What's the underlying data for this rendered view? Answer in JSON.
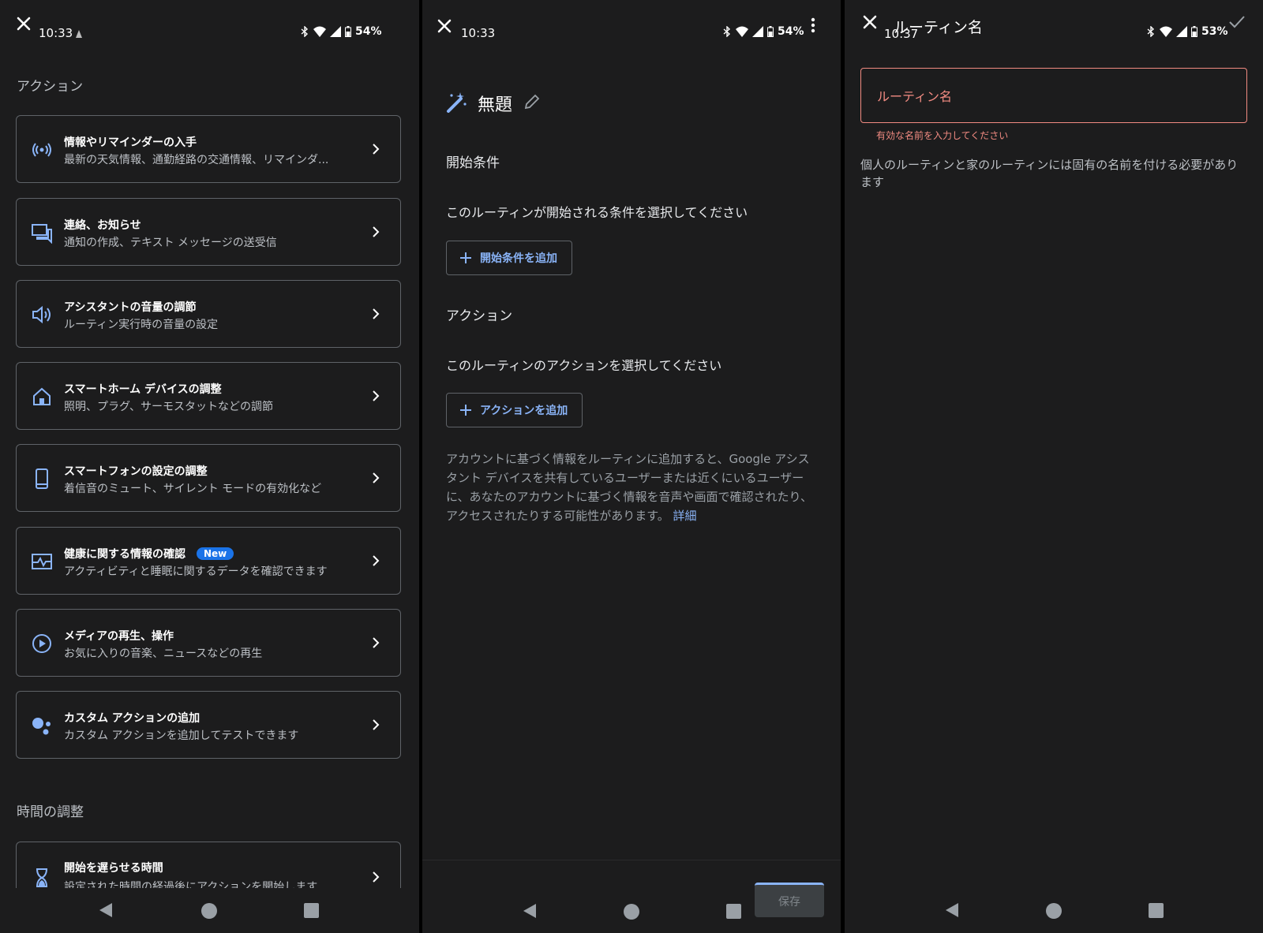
{
  "panel1": {
    "status": {
      "time": "10:33",
      "battery": "54%"
    },
    "section_actions": "アクション",
    "cards": [
      {
        "title": "情報やリマインダーの入手",
        "subtitle": "最新の天気情報、通勤経路の交通情報、リマインダ..."
      },
      {
        "title": "連絡、お知らせ",
        "subtitle": "通知の作成、テキスト メッセージの送受信"
      },
      {
        "title": "アシスタントの音量の調節",
        "subtitle": "ルーティン実行時の音量の設定"
      },
      {
        "title": "スマートホーム デバイスの調整",
        "subtitle": "照明、プラグ、サーモスタットなどの調節"
      },
      {
        "title": "スマートフォンの設定の調整",
        "subtitle": "着信音のミュート、サイレント モードの有効化など"
      },
      {
        "title": "健康に関する情報の確認",
        "badge": "New",
        "subtitle": "アクティビティと睡眠に関するデータを確認できます"
      },
      {
        "title": "メディアの再生、操作",
        "subtitle": "お気に入りの音楽、ニュースなどの再生"
      },
      {
        "title": "カスタム アクションの追加",
        "subtitle": "カスタム アクションを追加してテストできます"
      }
    ],
    "section_time": "時間の調整",
    "delay_card": {
      "title": "開始を遅らせる時間",
      "subtitle": "設定された時間の経過後にアクションを開始します"
    }
  },
  "panel2": {
    "status": {
      "time": "10:33",
      "battery": "54%"
    },
    "routine_title": "無題",
    "start_heading": "開始条件",
    "start_desc": "このルーティンが開始される条件を選択してください",
    "add_start_label": "開始条件を追加",
    "action_heading": "アクション",
    "action_desc": "このルーティンのアクションを選択してください",
    "add_action_label": "アクションを追加",
    "disclaimer": "アカウントに基づく情報をルーティンに追加すると、Google アシスタント デバイスを共有しているユーザーまたは近くにいるユーザーに、あなたのアカウントに基づく情報を音声や画面で確認されたり、アクセスされたりする可能性があります。",
    "details_link": "詳細",
    "save_label": "保存"
  },
  "panel3": {
    "status": {
      "time": "10:37",
      "battery": "53%"
    },
    "title": "ルーティン名",
    "input_placeholder": "ルーティン名",
    "error_text": "有効な名前を入力してください",
    "help_text": "個人のルーティンと家のルーティンには固有の名前を付ける必要があります"
  },
  "colors": {
    "background": "#1c1c1d",
    "accent": "#8ab4f8",
    "error": "#f28b82",
    "badge": "#1a73e8"
  }
}
